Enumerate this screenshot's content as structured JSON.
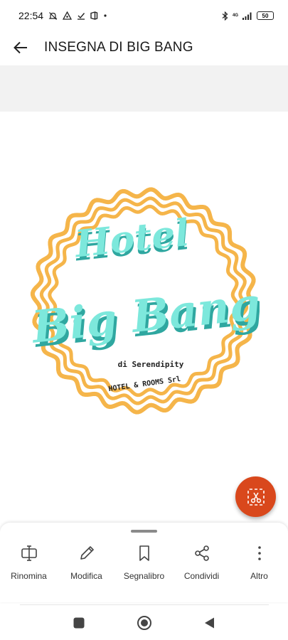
{
  "status_bar": {
    "time": "22:54",
    "network": "4G",
    "battery": "50",
    "icons": [
      "mute-icon",
      "triangle-alert-icon",
      "download-check-icon",
      "office-icon",
      "dot-icon",
      "bluetooth-icon",
      "signal-icon",
      "battery-icon"
    ]
  },
  "app_bar": {
    "title": "INSEGNA DI BIG BANG",
    "back_icon": "arrow-left-icon"
  },
  "image": {
    "line1": "Hotel",
    "line2": "Big Bang",
    "line3": "di Serendipity",
    "line4": "HOTEL & ROOMS Srl",
    "colors": {
      "ring": "#f5b54a",
      "text": "#7de8dc",
      "shadow": "#2fa7a0",
      "small_text": "#222222"
    }
  },
  "fab": {
    "icon": "scissors-crop-icon",
    "color": "#d9481c"
  },
  "actions": [
    {
      "label": "Rinomina",
      "icon": "rename-icon"
    },
    {
      "label": "Modifica",
      "icon": "pencil-icon"
    },
    {
      "label": "Segnalibro",
      "icon": "bookmark-icon"
    },
    {
      "label": "Condividi",
      "icon": "share-icon"
    },
    {
      "label": "Altro",
      "icon": "more-vertical-icon"
    }
  ],
  "nav": [
    "recents-icon",
    "home-icon",
    "back-triangle-icon"
  ]
}
